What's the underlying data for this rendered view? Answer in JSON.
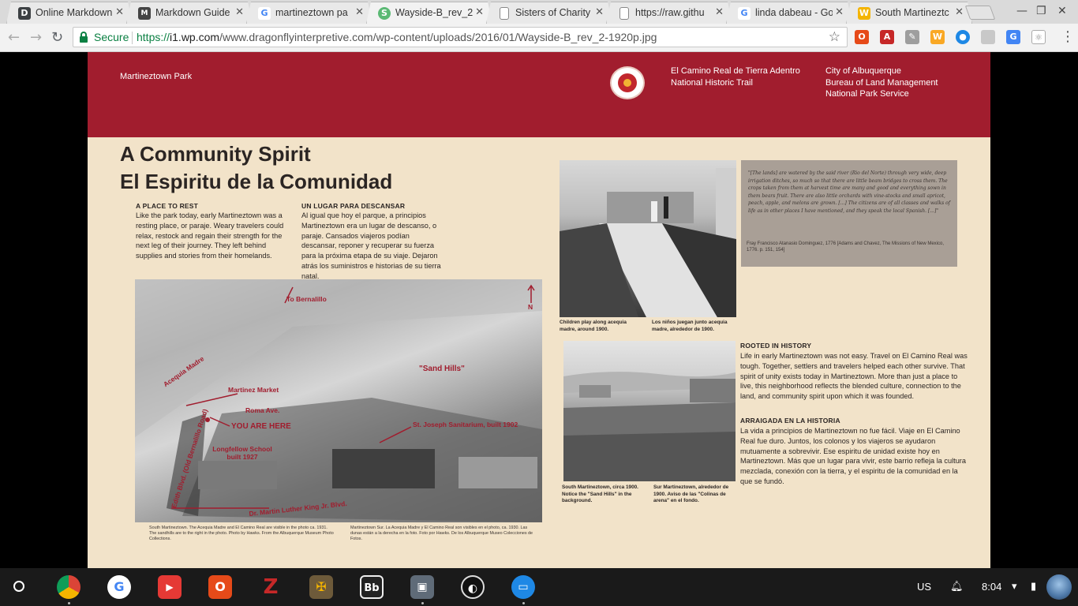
{
  "browser": {
    "tabs": [
      {
        "title": "Online Markdown",
        "icon": "D",
        "color": "#3c4043"
      },
      {
        "title": "Markdown Guide",
        "icon": "M",
        "color": "#444"
      },
      {
        "title": "martineztown pa",
        "icon": "G",
        "color": "#4285f4"
      },
      {
        "title": "Wayside-B_rev_2",
        "icon": "S",
        "color": "#5bb974"
      },
      {
        "title": "Sisters of Charity",
        "icon": "",
        "color": "#888"
      },
      {
        "title": "https://raw.githu",
        "icon": "",
        "color": "#888"
      },
      {
        "title": "linda dabeau - Go",
        "icon": "G",
        "color": "#4285f4"
      },
      {
        "title": "South Martineztc",
        "icon": "W",
        "color": "#f4b400"
      }
    ],
    "secure_label": "Secure",
    "url_scheme": "https://",
    "url_host": "i1.wp.com",
    "url_path": "/www.dragonflyinterpretive.com/wp-content/uploads/2016/01/Wayside-B_rev_2-1920p.jpg"
  },
  "sign": {
    "park_name": "Martineztown Park",
    "trail_line1": "El Camino Real de Tierra Adentro",
    "trail_line2": "National Historic Trail",
    "agency1": "City of Albuquerque",
    "agency2": "Bureau of Land Management",
    "agency3": "National Park Service",
    "title_en": "A Community Spirit",
    "title_es": "El Espiritu de la Comunidad",
    "rest_head_en": "A PLACE TO REST",
    "rest_body_en": "Like the park today, early Martineztown was a resting place, or paraje. Weary travelers could relax, restock and regain their strength for the next leg of their journey. They left behind supplies and stories from their homelands.",
    "rest_head_es": "UN LUGAR PARA DESCANSAR",
    "rest_body_es": "Al igual que hoy el parque, a principios Martineztown era un lugar de descanso, o paraje. Cansados viajeros podían descansar, reponer y recuperar su fuerza para la próxima etapa de su viaje. Dejaron atrás los suministros e historias de su tierra natal.",
    "map_labels": {
      "bernalillo": "To Bernalillo",
      "north": "N",
      "sand_hills": "\"Sand Hills\"",
      "acequia": "Acequia Madre",
      "market": "Martinez Market",
      "roma": "Roma Ave.",
      "here": "YOU ARE HERE",
      "sanitarium": "St. Joseph Sanitarium, built 1902",
      "school": "Longfellow School built 1927",
      "edith": "Edith Blvd. (Old Bernalillo Road)",
      "mlk": "Dr. Martin Luther King Jr. Blvd."
    },
    "aerial_caption_en": "South Martineztown. The Acequia Madre and El Camino Real are visible in the photo ca. 1931. The sandhills are to the right in the photo. Photo by Hawks. From the Albuquerque Museum Photo Collections.",
    "aerial_caption_es": "Martineztown Sur. La Acequia Madre y El Camino Real son visibles en el photo, ca. 1930. Las dunas están a la derecha en la foto. Foto por Hawks. De los Albuquerque Museo Colecciones de Fotos.",
    "photo1_caption_en": "Children play along acequia madre, around 1900.",
    "photo1_caption_es": "Los niños juegan junto acequia madre, alrededor de 1900.",
    "quote": "\"[The lands] are watered by the said river (Rio del Norte) through very wide, deep irrigation ditches, so much so that there are little beam bridges to cross them. The crops taken from them at harvest time are many and good and everything sown in them bears fruit. There are also little orchards with vine-stocks and small apricot, peach, apple, and melons are grown. [...] The citizens are of all classes and walks of life as in other places I have mentioned, and they speak the local Spanish. [...]\"",
    "quote_source": "Fray Francisco Atanasio Dominguez, 1776 [Adams and Chavez, The Missions of New Mexico, 1776. p. 151, 154]",
    "rooted_head_en": "ROOTED IN HISTORY",
    "rooted_body_en": "Life in early Martineztown was not easy. Travel on El Camino Real was tough. Together, settlers and travelers helped each other survive. That spirit of unity exists today in Martineztown. More than just a place to live, this neighborhood reflects the blended culture, connection to the land, and community spirit upon which it was founded.",
    "rooted_head_es": "ARRAIGADA EN LA HISTORIA",
    "rooted_body_es": "La vida a principios de Martineztown no fue fácil. Viaje en El Camino Real fue duro. Juntos, los colonos y los viajeros se ayudaron mutuamente a sobrevivir. Ese espiritu de unidad existe hoy en Martineztown. Más que un lugar para vivir, este barrio refleja la cultura mezclada, conexión con la tierra, y el espiritu de la comunidad en la que se fundó.",
    "photo2_caption_en": "South Martineztown, circa 1900. Notice the \"Sand Hills\" in the background.",
    "photo2_caption_es": "Sur Martineztown, alrededor de 1900. Aviso de las \"Colinas de arena\" en el fondo."
  },
  "shelf": {
    "locale": "US",
    "time": "8:04"
  }
}
